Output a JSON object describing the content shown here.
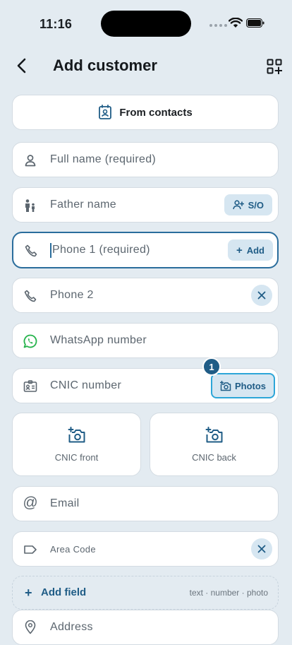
{
  "status": {
    "time": "11:16"
  },
  "header": {
    "title": "Add customer"
  },
  "contacts_button": {
    "label": "From contacts"
  },
  "fields": {
    "full_name": {
      "placeholder": "Full name (required)"
    },
    "father_name": {
      "placeholder": "Father name",
      "chip": "S/O"
    },
    "phone1": {
      "placeholder": "Phone 1 (required)",
      "chip": "Add"
    },
    "phone2": {
      "placeholder": "Phone 2"
    },
    "whatsapp": {
      "placeholder": "WhatsApp number"
    },
    "cnic": {
      "placeholder": "CNIC number",
      "photos_label": "Photos",
      "badge": "1"
    },
    "email": {
      "placeholder": "Email"
    },
    "area_code": {
      "placeholder": "Area Code"
    },
    "address": {
      "placeholder": "Address"
    }
  },
  "cnic_tiles": {
    "front": "CNIC front",
    "back": "CNIC back"
  },
  "add_field": {
    "label": "Add field",
    "hint": "text · number · photo",
    "plus": "+"
  },
  "colors": {
    "accent": "#1f5c86",
    "focus_ring": "#2ca6d8",
    "chip_bg": "#d6e6f1",
    "whatsapp": "#25b34b"
  }
}
